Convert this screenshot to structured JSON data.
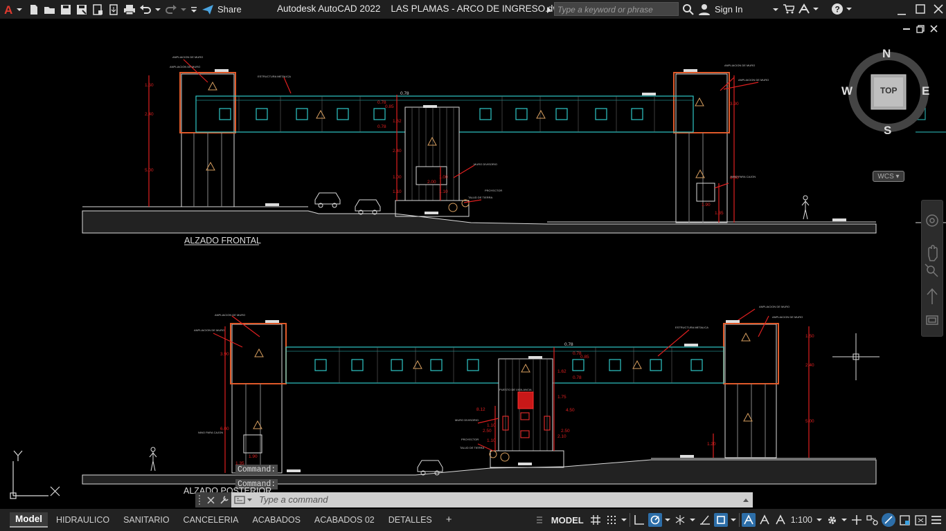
{
  "titlebar": {
    "app_title": "Autodesk AutoCAD 2022",
    "document_name": "LAS PLAMAS - ARCO DE INGRESO.dwg",
    "share_label": "Share",
    "search_placeholder": "Type a keyword or phrase",
    "signin_label": "Sign In",
    "accent_color": "#e03a2f"
  },
  "drawing": {
    "front_title": "ALZADO FRONTAL",
    "rear_title": "ALZADO POSTERIOR",
    "dims_front": [
      "1.50",
      "2.40",
      "5.00",
      "3.90",
      "0.78",
      "0.85",
      "0.78",
      "1.62",
      "2.40",
      "1.00",
      "1.00",
      "2.00",
      "1.10",
      "1.10",
      "6.00",
      "1.90",
      "1.35"
    ],
    "dims_rear": [
      "3.90",
      "1.50",
      "2.40",
      "5.00",
      "0.78",
      "0.78",
      "0.85",
      "0.78",
      "1.62",
      "1.75",
      "4.50",
      "2.50",
      "2.10",
      "1.10",
      "1.10",
      "8.12",
      "2.50",
      "6.00",
      "1.90",
      "1.35",
      "1.20"
    ],
    "colors": {
      "outline": "#e8e8e8",
      "beam": "#2fc7c7",
      "frame": "#e05a2a",
      "dimension": "#e02020",
      "symbol": "#d9a060"
    }
  },
  "viewcube": {
    "north": "N",
    "south": "S",
    "east": "E",
    "west": "W",
    "face": "TOP",
    "ucs_label": "WCS"
  },
  "ucs_icon": {
    "x_label": "X",
    "y_label": "Y"
  },
  "command": {
    "history": [
      "Command:",
      "Command:"
    ],
    "placeholder": "Type a command"
  },
  "layout_tabs": [
    "Model",
    "HIDRAULICO",
    "SANITARIO",
    "CANCELERIA",
    "ACABADOS",
    "ACABADOS 02",
    "DETALLES"
  ],
  "status": {
    "model_label": "MODEL",
    "scale_label": "1:100"
  }
}
